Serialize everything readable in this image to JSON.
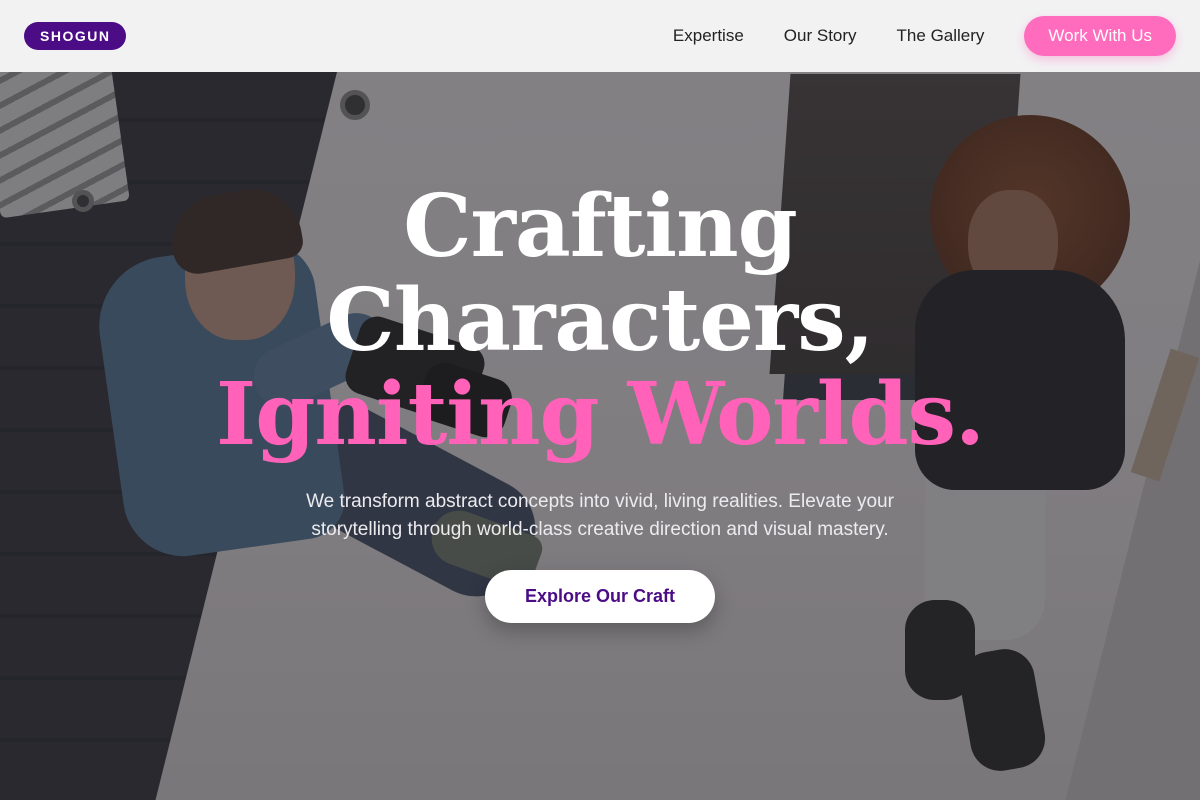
{
  "nav": {
    "logo": "SHOGUN",
    "links": [
      "Expertise",
      "Our Story",
      "The Gallery"
    ],
    "cta": "Work With Us"
  },
  "hero": {
    "headline_line1": "Crafting",
    "headline_line2": "Characters,",
    "headline_accent": "Igniting Worlds.",
    "subtitle": "We transform abstract concepts into vivid, living realities. Elevate your storytelling through world-class creative direction and visual mastery.",
    "button": "Explore Our Craft"
  },
  "colors": {
    "brand_purple": "#4b0c86",
    "accent_pink": "#ff62b8",
    "nav_bg": "#f2f2f3"
  }
}
